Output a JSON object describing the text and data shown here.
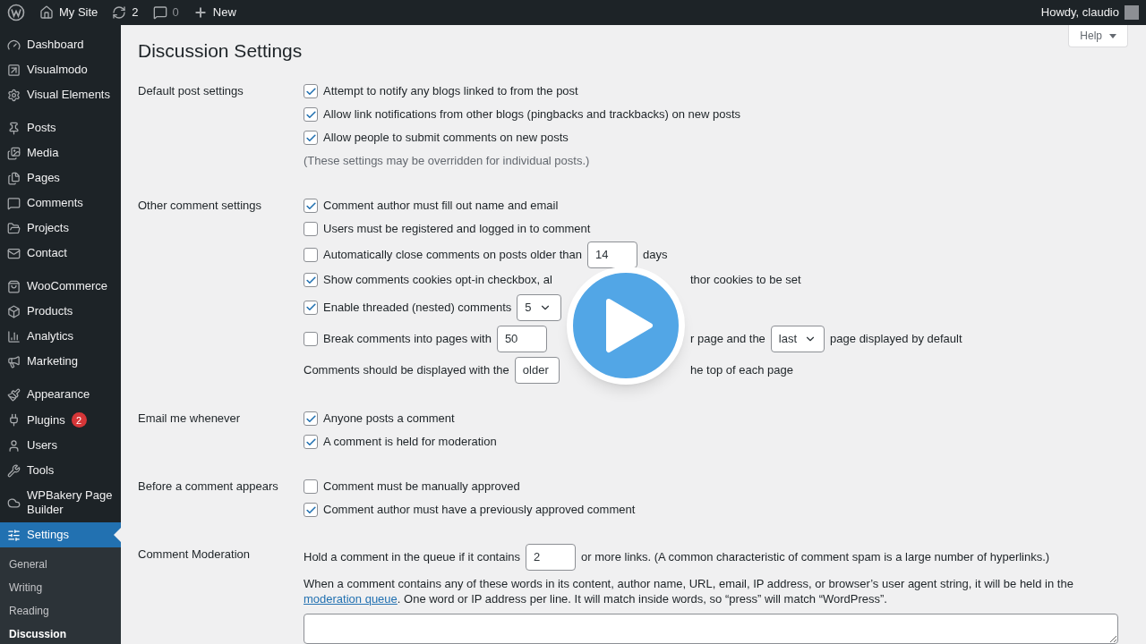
{
  "admin_bar": {
    "site": "My Site",
    "updates": "2",
    "comments": "0",
    "new": "New",
    "greeting": "Howdy, claudio"
  },
  "sidebar": {
    "groups": [
      {
        "items": [
          {
            "label": "Dashboard",
            "selected": false
          },
          {
            "label": "Visualmodo",
            "selected": false
          },
          {
            "label": "Visual Elements",
            "selected": false
          }
        ]
      },
      {
        "items": [
          {
            "label": "Posts",
            "selected": false
          },
          {
            "label": "Media",
            "selected": false
          },
          {
            "label": "Pages",
            "selected": false
          },
          {
            "label": "Comments",
            "selected": false
          },
          {
            "label": "Projects",
            "selected": false
          },
          {
            "label": "Contact",
            "selected": false
          }
        ]
      },
      {
        "items": [
          {
            "label": "WooCommerce",
            "selected": false
          },
          {
            "label": "Products",
            "selected": false
          },
          {
            "label": "Analytics",
            "selected": false
          },
          {
            "label": "Marketing",
            "selected": false
          }
        ]
      },
      {
        "items": [
          {
            "label": "Appearance",
            "selected": false
          },
          {
            "label": "Plugins",
            "selected": false,
            "badge": "2"
          },
          {
            "label": "Users",
            "selected": false
          },
          {
            "label": "Tools",
            "selected": false
          },
          {
            "label": "WPBakery Page Builder",
            "selected": false
          },
          {
            "label": "Settings",
            "selected": true
          }
        ]
      }
    ],
    "submenu": [
      {
        "label": "General",
        "selected": false
      },
      {
        "label": "Writing",
        "selected": false
      },
      {
        "label": "Reading",
        "selected": false
      },
      {
        "label": "Discussion",
        "selected": true
      }
    ]
  },
  "help_button": "Help",
  "title": "Discussion Settings",
  "sections": [
    {
      "label": "Default post settings",
      "items": [
        {
          "kind": "checkbox",
          "checked": true,
          "before": [
            {
              "kind": "text",
              "text": "Attempt to notify any blogs linked to from the post"
            }
          ]
        },
        {
          "kind": "checkbox",
          "checked": true,
          "before": [
            {
              "kind": "text",
              "text": "Allow link notifications from other blogs (pingbacks and trackbacks) on new posts"
            }
          ]
        },
        {
          "kind": "checkbox",
          "checked": true,
          "before": [
            {
              "kind": "text",
              "text": "Allow people to submit comments on new posts"
            }
          ]
        },
        {
          "kind": "note",
          "before": [
            {
              "kind": "text",
              "text": "(These settings may be overridden for individual posts.)"
            }
          ]
        }
      ]
    },
    {
      "label": "Other comment settings",
      "items": [
        {
          "kind": "checkbox",
          "checked": true,
          "before": [
            {
              "kind": "text",
              "text": "Comment author must fill out name and email"
            }
          ]
        },
        {
          "kind": "checkbox",
          "checked": false,
          "before": [
            {
              "kind": "text",
              "text": "Users must be registered and logged in to comment"
            }
          ]
        },
        {
          "kind": "checkbox",
          "checked": false,
          "before": [
            {
              "kind": "text",
              "text": "Automatically close comments on posts older than"
            },
            {
              "kind": "input",
              "value": "14"
            },
            {
              "kind": "text",
              "text": "days"
            }
          ]
        },
        {
          "kind": "checkbox",
          "checked": true,
          "before": [
            {
              "kind": "text",
              "text": "Show comments cookies opt-in checkbox, al"
            }
          ],
          "after": [
            {
              "kind": "text",
              "text": "thor cookies to be set"
            }
          ]
        },
        {
          "kind": "checkbox",
          "checked": true,
          "before": [
            {
              "kind": "text",
              "text": "Enable threaded (nested) comments"
            },
            {
              "kind": "select",
              "value": "5"
            }
          ]
        },
        {
          "kind": "checkbox",
          "checked": false,
          "before": [
            {
              "kind": "text",
              "text": "Break comments into pages with"
            },
            {
              "kind": "input",
              "value": "50"
            }
          ],
          "after": [
            {
              "kind": "text",
              "text": "r page and the"
            },
            {
              "kind": "select",
              "value": "last"
            },
            {
              "kind": "text",
              "text": "page displayed by default"
            }
          ]
        },
        {
          "kind": "plain",
          "before": [
            {
              "kind": "text",
              "text": "Comments should be displayed with the"
            },
            {
              "kind": "select",
              "value": "older"
            }
          ],
          "after": [
            {
              "kind": "text",
              "text": "he top of each page"
            }
          ]
        }
      ]
    },
    {
      "label": "Email me whenever",
      "items": [
        {
          "kind": "checkbox",
          "checked": true,
          "before": [
            {
              "kind": "text",
              "text": "Anyone posts a comment"
            }
          ]
        },
        {
          "kind": "checkbox",
          "checked": true,
          "before": [
            {
              "kind": "text",
              "text": "A comment is held for moderation"
            }
          ]
        }
      ]
    },
    {
      "label": "Before a comment appears",
      "items": [
        {
          "kind": "checkbox",
          "checked": false,
          "before": [
            {
              "kind": "text",
              "text": "Comment must be manually approved"
            }
          ]
        },
        {
          "kind": "checkbox",
          "checked": true,
          "before": [
            {
              "kind": "text",
              "text": "Comment author must have a previously approved comment"
            }
          ]
        }
      ]
    },
    {
      "label": "Comment Moderation",
      "items": [
        {
          "kind": "plain",
          "before": [
            {
              "kind": "text",
              "text": "Hold a comment in the queue if it contains"
            },
            {
              "kind": "input",
              "value": "2"
            },
            {
              "kind": "text",
              "text": "or more links. (A common characteristic of comment spam is a large number of hyperlinks.)"
            }
          ]
        },
        {
          "kind": "paragraph",
          "text_before": "When a comment contains any of these words in its content, author name, URL, email, IP address, or browser’s user agent string, it will be held in the",
          "link": "moderation queue",
          "text_after": ". One word or IP address per line. It will match inside words, so “press” will match “WordPress”."
        },
        {
          "kind": "textarea"
        }
      ]
    }
  ]
}
